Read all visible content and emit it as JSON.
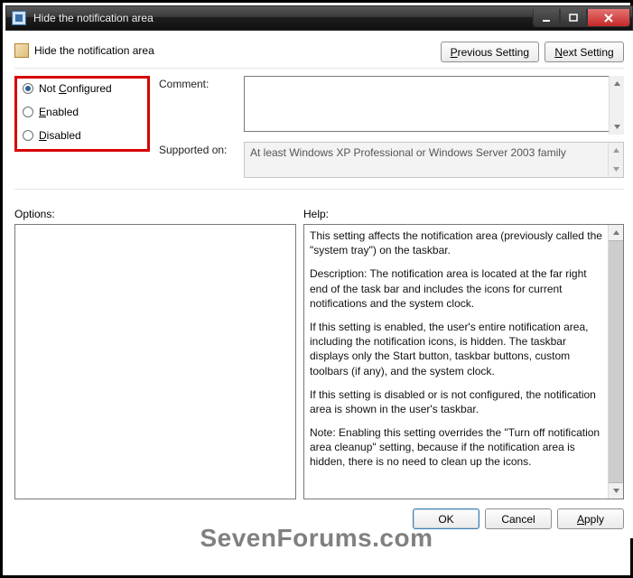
{
  "titlebar": {
    "title": "Hide the notification area"
  },
  "header": {
    "title": "Hide the notification area",
    "prev_label": "Previous Setting",
    "prev_ul": "P",
    "next_label": "Next Setting",
    "next_ul": "N"
  },
  "state": {
    "not_configured_label": "Not Configured",
    "not_configured_ul": "C",
    "enabled_label": "Enabled",
    "enabled_ul": "E",
    "disabled_label": "Disabled",
    "disabled_ul": "D",
    "selected": "not_configured"
  },
  "comment": {
    "label": "Comment:",
    "value": ""
  },
  "supported": {
    "label": "Supported on:",
    "text": "At least Windows XP Professional or Windows Server 2003 family"
  },
  "options": {
    "label": "Options:"
  },
  "help": {
    "label": "Help:",
    "p1": "This setting affects the notification area (previously called the \"system tray\") on the taskbar.",
    "p2": "Description: The notification area is located at the far right end of the task bar and includes the icons for current notifications and the system clock.",
    "p3": "If this setting is enabled, the user's entire notification area, including the notification icons, is hidden. The taskbar displays only the Start button, taskbar buttons, custom toolbars (if any), and the system clock.",
    "p4": "If this setting is disabled or is not configured, the notification area is shown in the user's taskbar.",
    "p5": "Note: Enabling this setting overrides the \"Turn off notification area cleanup\" setting, because if the notification area is hidden, there is no need to clean up the icons."
  },
  "footer": {
    "ok": "OK",
    "cancel": "Cancel",
    "apply": "Apply",
    "apply_ul": "A"
  },
  "watermark": "SevenForums.com"
}
